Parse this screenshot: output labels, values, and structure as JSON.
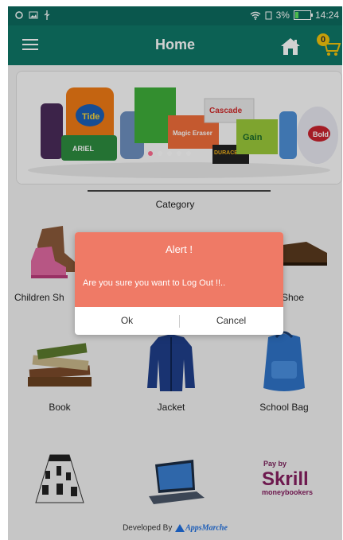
{
  "statusbar": {
    "battery": "3%",
    "time": "14:24",
    "battery_level": 0.2
  },
  "topbar": {
    "title": "Home"
  },
  "cart": {
    "count": "0"
  },
  "category": {
    "label": "Category"
  },
  "grid": [
    {
      "label": "Children Sh"
    },
    {
      "label": "Shoe"
    },
    {
      "label": "Book"
    },
    {
      "label": "Jacket"
    },
    {
      "label": "School Bag"
    }
  ],
  "banner": {
    "labels": [
      "Tide",
      "Cascade",
      "ARIEL",
      "Gain",
      "Bold",
      "DURACELL",
      "Magic Eraser"
    ]
  },
  "skrill": {
    "pay_by": "Pay by",
    "name": "Skrill",
    "sub": "moneybookers"
  },
  "footer": {
    "developed_by": "Developed By",
    "brand_a": "A",
    "brand_rest": "ppsMarche"
  },
  "alert": {
    "title": "Alert !",
    "message": "Are you sure you want to Log Out !!..",
    "ok": "Ok",
    "cancel": "Cancel"
  },
  "colors": {
    "statusbar": "#0d6b5e",
    "topbar": "#0f7767",
    "dialog_header": "#ef7a66",
    "badge": "#f2c20b"
  }
}
